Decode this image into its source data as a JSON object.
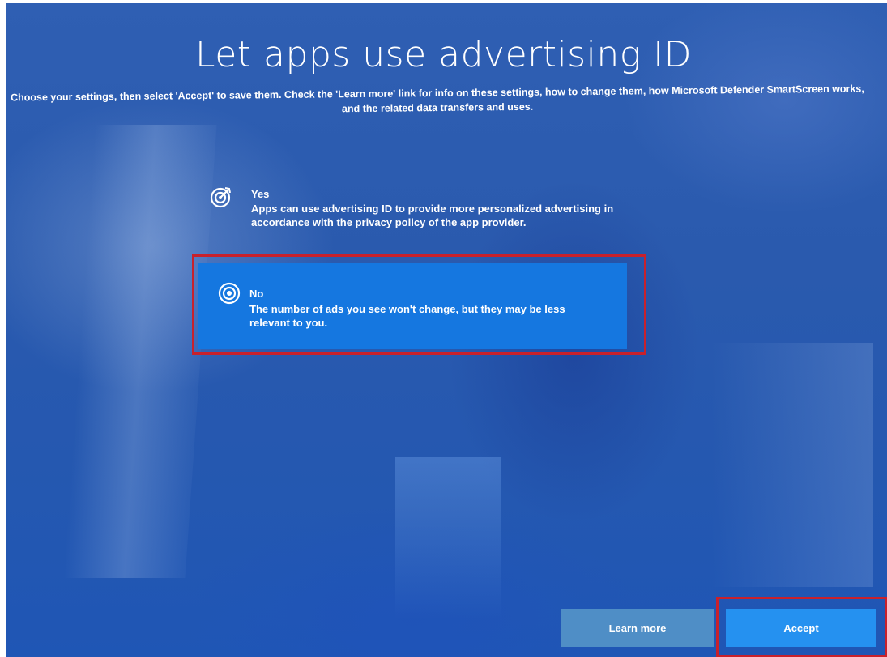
{
  "page": {
    "title": "Let apps use advertising ID",
    "subtitle": "Choose your settings, then select 'Accept' to save them. Check the 'Learn more' link for info on these settings, how to change them, how Microsoft Defender SmartScreen works, and the related data transfers and uses."
  },
  "options": [
    {
      "title": "Yes",
      "description": "Apps can use advertising ID to provide more personalized advertising in accordance with the privacy policy of the app provider.",
      "icon": "target-icon",
      "selected": false
    },
    {
      "title": "No",
      "description": "The number of ads you see won't change, but they may be less relevant to you.",
      "icon": "radio-target-icon",
      "selected": true
    }
  ],
  "buttons": {
    "learn_more": "Learn more",
    "accept": "Accept"
  },
  "colors": {
    "selected_option_bg": "#1577e0",
    "accept_bg": "#2591f0",
    "learn_more_bg": "#4f8ec6",
    "highlight_border": "#c8212c"
  }
}
